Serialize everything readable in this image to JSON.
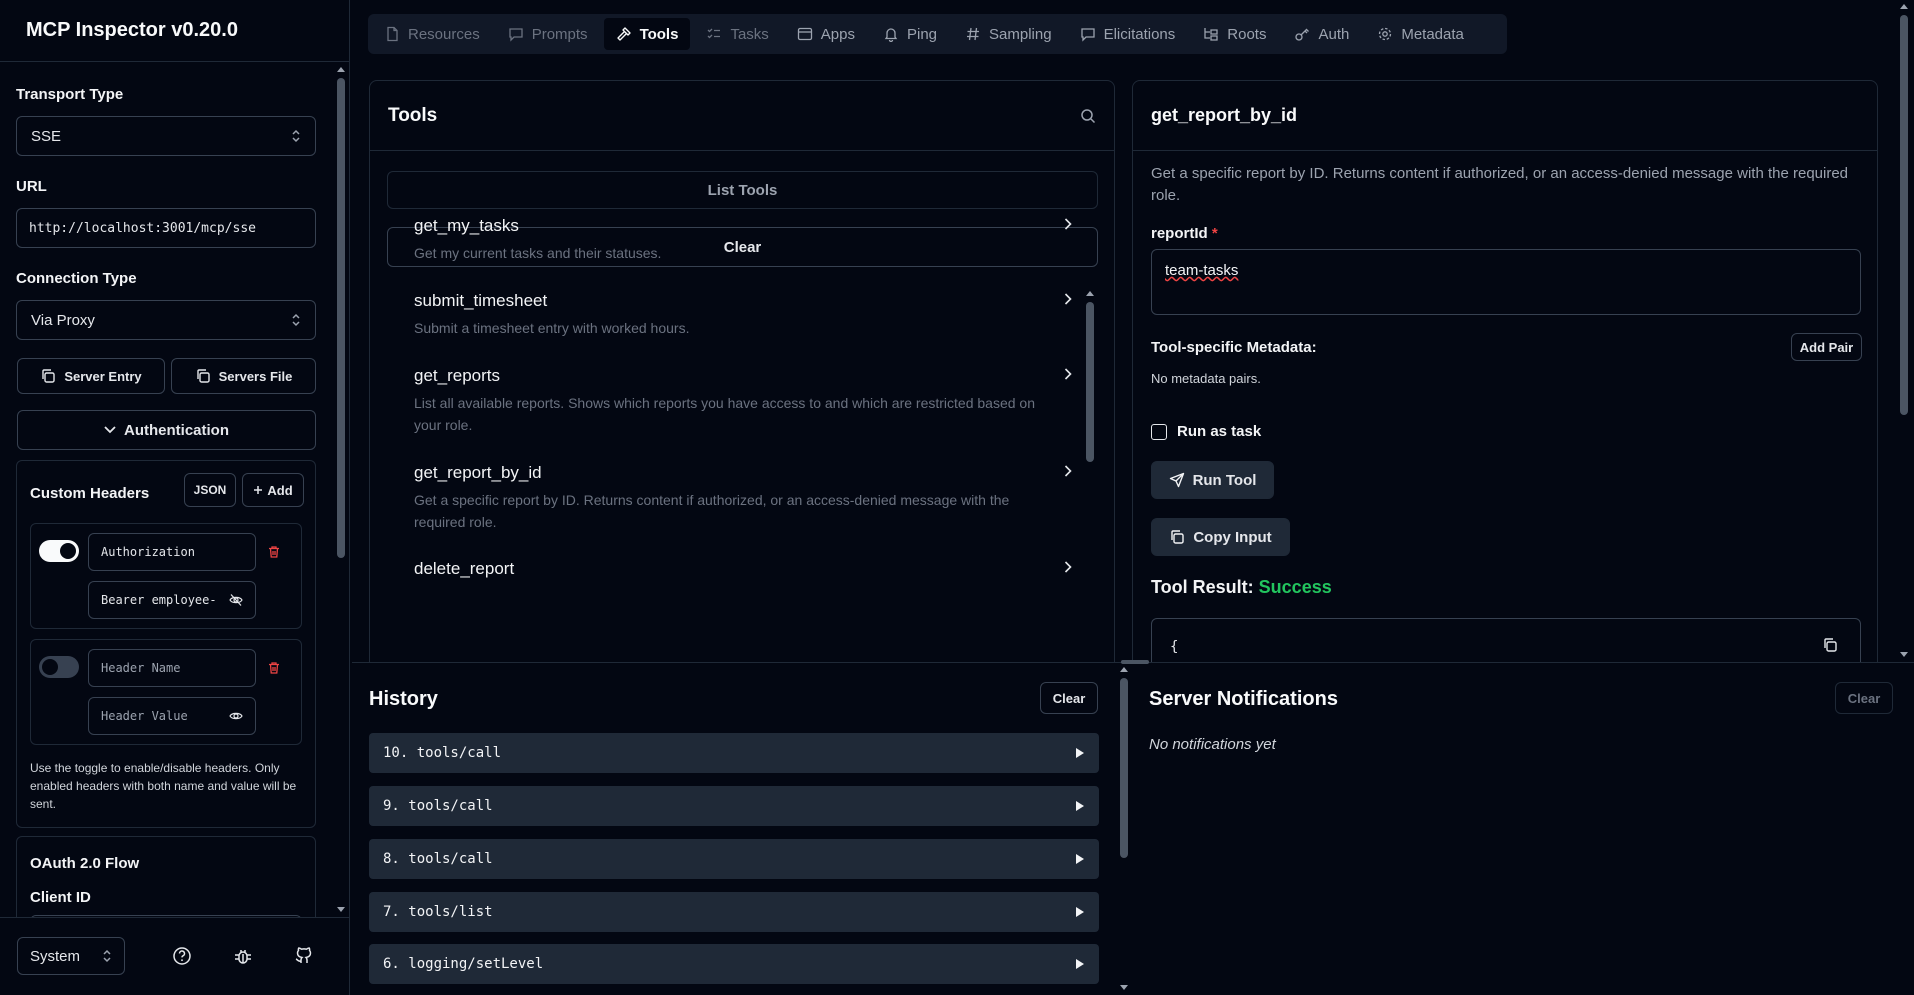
{
  "app": {
    "title": "MCP Inspector v0.20.0"
  },
  "sidebar": {
    "transport_label": "Transport Type",
    "transport_value": "SSE",
    "url_label": "URL",
    "url_value": "http://localhost:3001/mcp/sse",
    "connection_label": "Connection Type",
    "connection_value": "Via Proxy",
    "server_entry": "Server Entry",
    "servers_file": "Servers File",
    "authentication": "Authentication",
    "custom_headers": "Custom Headers",
    "json_btn": "JSON",
    "add_btn": "Add",
    "header1": {
      "name": "Authorization",
      "value": "Bearer employee-",
      "enabled": true
    },
    "header2": {
      "name_placeholder": "Header Name",
      "value_placeholder": "Header Value",
      "enabled": false
    },
    "help_text": "Use the toggle to enable/disable headers. Only enabled headers with both name and value will be sent.",
    "oauth_title": "OAuth 2.0 Flow",
    "client_id": "Client ID",
    "theme": "System"
  },
  "tabs": [
    {
      "label": "Resources",
      "icon": "file-icon",
      "state": "dim"
    },
    {
      "label": "Prompts",
      "icon": "message-icon",
      "state": "dim"
    },
    {
      "label": "Tools",
      "icon": "hammer-icon",
      "state": "active"
    },
    {
      "label": "Tasks",
      "icon": "list-checks-icon",
      "state": "dim"
    },
    {
      "label": "Apps",
      "icon": "app-window-icon",
      "state": "normal"
    },
    {
      "label": "Ping",
      "icon": "bell-icon",
      "state": "normal"
    },
    {
      "label": "Sampling",
      "icon": "hash-icon",
      "state": "normal"
    },
    {
      "label": "Elicitations",
      "icon": "message-square-icon",
      "state": "normal"
    },
    {
      "label": "Roots",
      "icon": "folder-tree-icon",
      "state": "normal"
    },
    {
      "label": "Auth",
      "icon": "key-icon",
      "state": "normal"
    },
    {
      "label": "Metadata",
      "icon": "gear-icon",
      "state": "normal"
    }
  ],
  "tools_panel": {
    "title": "Tools",
    "list_tools": "List Tools",
    "clear": "Clear",
    "items": [
      {
        "name": "get_my_tasks",
        "desc": "Get my current tasks and their statuses."
      },
      {
        "name": "submit_timesheet",
        "desc": "Submit a timesheet entry with worked hours."
      },
      {
        "name": "get_reports",
        "desc": "List all available reports. Shows which reports you have access to and which are restricted based on your role."
      },
      {
        "name": "get_report_by_id",
        "desc": "Get a specific report by ID. Returns content if authorized, or an access-denied message with the required role."
      },
      {
        "name": "delete_report",
        "desc": ""
      }
    ]
  },
  "detail": {
    "title": "get_report_by_id",
    "description": "Get a specific report by ID. Returns content if authorized, or an access-denied message with the required role.",
    "param_label": "reportId",
    "required_mark": "*",
    "param_value": "team-tasks",
    "metadata_label": "Tool-specific Metadata:",
    "add_pair": "Add Pair",
    "no_metadata": "No metadata pairs.",
    "run_as_task": "Run as task",
    "run_tool": "Run Tool",
    "copy_input": "Copy Input",
    "result_label": "Tool Result:",
    "result_status": "Success",
    "result_preview": "{"
  },
  "history": {
    "title": "History",
    "clear": "Clear",
    "items": [
      "10. tools/call",
      "9. tools/call",
      "8. tools/call",
      "7. tools/list",
      "6. logging/setLevel"
    ]
  },
  "notifications": {
    "title": "Server Notifications",
    "clear": "Clear",
    "empty": "No notifications yet"
  },
  "colors": {
    "bg": "#030712",
    "border": "#1f2937",
    "success": "#22c55e",
    "required": "#ef4444"
  }
}
